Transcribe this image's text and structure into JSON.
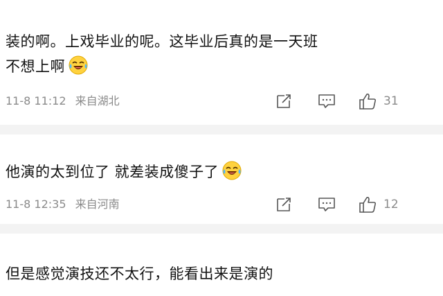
{
  "comments": [
    {
      "text_line1": "装的啊。上戏毕业的呢。这毕业后真的是一天班",
      "text_line2": "不想上啊",
      "time": "11-8 11:12",
      "location": "来自湖北",
      "likes": "31"
    },
    {
      "text_line1": "他演的太到位了 就差装成傻子了",
      "time": "11-8 12:35",
      "location": "来自河南",
      "likes": "12"
    },
    {
      "text_line1": "但是感觉演技还不太行，能看出来是演的"
    }
  ],
  "icons": {
    "share": "share-icon",
    "comment": "comment-icon",
    "like": "thumbs-up-icon",
    "emoji": "laugh-cry-emoji-icon"
  }
}
